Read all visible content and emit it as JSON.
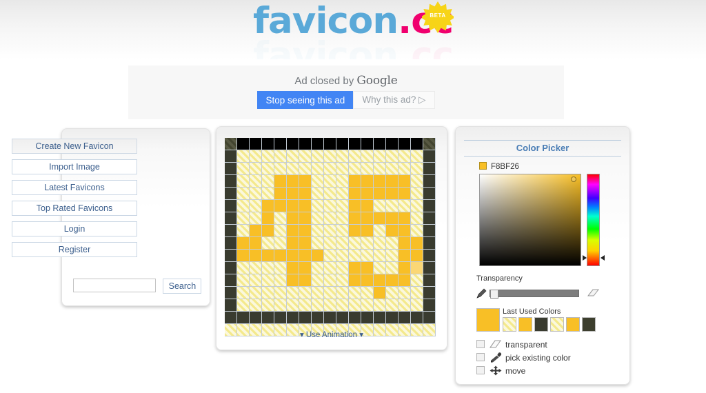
{
  "site": {
    "logo_part_blue": "favicon",
    "logo_part_dot": ".",
    "logo_part_pink": "cc",
    "logo_full": "favicon.cc",
    "beta_badge": "BETA",
    "logo_blue_color": "#5AA9D8",
    "logo_pink_color": "#F0006E",
    "beta_color": "#F7D417"
  },
  "ad": {
    "closed_text_prefix": "Ad closed by ",
    "closed_text_brand": "Google",
    "stop_seeing_label": "Stop seeing this ad",
    "why_this_ad_label": "Why this ad? ▷",
    "stop_button_color": "#4285F4"
  },
  "menu": {
    "items": [
      {
        "label": "Create New Favicon",
        "active": true
      },
      {
        "label": "Import Image",
        "active": false
      },
      {
        "label": "Latest Favicons",
        "active": false
      },
      {
        "label": "Top Rated Favicons",
        "active": false
      },
      {
        "label": "Login",
        "active": false
      },
      {
        "label": "Register",
        "active": false
      }
    ],
    "search_value": "",
    "search_placeholder": "",
    "search_button_label": "Search"
  },
  "editor": {
    "use_animation_label": "▾ Use Animation ▾",
    "grid_cols": 17,
    "grid_rows": 16,
    "palette": {
      "empty": "#F6F0B4",
      "yellow": "#F8BF26",
      "yellow_light": "#FBD775",
      "dark": "#393B2F",
      "black": "#000000",
      "darkolive": "#4A4B38"
    },
    "grid": [
      [
        "darkolive",
        "black",
        "black",
        "black",
        "black",
        "black",
        "black",
        "black",
        "black",
        "black",
        "black",
        "black",
        "black",
        "black",
        "black",
        "black",
        "darkolive"
      ],
      [
        "dark",
        "empty",
        "empty",
        "empty",
        "empty",
        "empty",
        "empty",
        "empty",
        "empty",
        "empty",
        "empty",
        "empty",
        "empty",
        "empty",
        "empty",
        "empty",
        "dark"
      ],
      [
        "dark",
        "empty",
        "empty",
        "empty",
        "empty",
        "empty",
        "empty",
        "empty",
        "empty",
        "empty",
        "empty",
        "empty",
        "empty",
        "empty",
        "empty",
        "empty",
        "dark"
      ],
      [
        "dark",
        "empty",
        "empty",
        "empty",
        "yellow",
        "yellow",
        "yellow",
        "empty",
        "empty",
        "empty",
        "yellow",
        "yellow",
        "yellow",
        "yellow",
        "yellow",
        "empty",
        "dark"
      ],
      [
        "dark",
        "empty",
        "empty",
        "empty",
        "yellow",
        "yellow",
        "yellow",
        "empty",
        "empty",
        "empty",
        "yellow",
        "yellow",
        "yellow",
        "yellow",
        "yellow",
        "empty",
        "dark"
      ],
      [
        "dark",
        "empty",
        "empty",
        "yellow",
        "yellow",
        "yellow",
        "yellow",
        "empty",
        "empty",
        "empty",
        "yellow",
        "yellow",
        "empty",
        "empty",
        "empty",
        "empty",
        "dark"
      ],
      [
        "dark",
        "empty",
        "empty",
        "yellow",
        "empty",
        "yellow",
        "yellow",
        "empty",
        "empty",
        "empty",
        "yellow",
        "yellow",
        "yellow",
        "yellow",
        "yellow",
        "empty",
        "dark"
      ],
      [
        "dark",
        "empty",
        "yellow",
        "yellow",
        "empty",
        "yellow",
        "yellow",
        "empty",
        "empty",
        "empty",
        "yellow",
        "yellow",
        "empty",
        "yellow",
        "yellow",
        "empty",
        "dark"
      ],
      [
        "dark",
        "yellow",
        "yellow",
        "empty",
        "empty",
        "yellow",
        "yellow",
        "empty",
        "empty",
        "empty",
        "empty",
        "empty",
        "empty",
        "empty",
        "yellow",
        "yellow",
        "dark"
      ],
      [
        "dark",
        "yellow",
        "yellow",
        "yellow",
        "yellow",
        "yellow",
        "yellow",
        "yellow",
        "empty",
        "empty",
        "empty",
        "empty",
        "empty",
        "empty",
        "yellow",
        "yellow",
        "dark"
      ],
      [
        "dark",
        "empty",
        "empty",
        "empty",
        "empty",
        "yellow",
        "yellow",
        "empty",
        "empty",
        "empty",
        "yellow",
        "yellow",
        "empty",
        "empty",
        "yellow",
        "yellow_light",
        "dark"
      ],
      [
        "dark",
        "empty",
        "empty",
        "empty",
        "empty",
        "yellow",
        "yellow",
        "empty",
        "empty",
        "empty",
        "yellow",
        "yellow",
        "yellow",
        "yellow",
        "yellow",
        "empty",
        "dark"
      ],
      [
        "dark",
        "empty",
        "empty",
        "empty",
        "empty",
        "empty",
        "empty",
        "empty",
        "empty",
        "empty",
        "empty",
        "empty",
        "yellow",
        "empty",
        "empty",
        "empty",
        "dark"
      ],
      [
        "dark",
        "empty",
        "empty",
        "empty",
        "empty",
        "empty",
        "empty",
        "empty",
        "empty",
        "empty",
        "empty",
        "empty",
        "empty",
        "empty",
        "empty",
        "empty",
        "dark"
      ],
      [
        "dark",
        "dark",
        "dark",
        "dark",
        "dark",
        "dark",
        "dark",
        "dark",
        "dark",
        "dark",
        "dark",
        "dark",
        "dark",
        "dark",
        "dark",
        "dark",
        "dark"
      ],
      [
        "empty",
        "empty",
        "empty",
        "empty",
        "empty",
        "empty",
        "empty",
        "empty",
        "empty",
        "empty",
        "empty",
        "empty",
        "empty",
        "empty",
        "empty",
        "empty",
        "empty"
      ]
    ]
  },
  "picker": {
    "title": "Color Picker",
    "hex_value": "F8BF26",
    "current_color": "#F8BF26",
    "transparency_label": "Transparency",
    "transparency_percent": 0,
    "last_used_label": "Last Used Colors",
    "last_used_colors": [
      {
        "name": "transparent",
        "hex": "transparent"
      },
      {
        "name": "yellow",
        "hex": "#F8BF26"
      },
      {
        "name": "dark",
        "hex": "#393B2F"
      },
      {
        "name": "transparent",
        "hex": "transparent"
      },
      {
        "name": "yellow",
        "hex": "#F8BF26"
      },
      {
        "name": "darkolive",
        "hex": "#3D3F2E"
      }
    ],
    "tools": [
      {
        "label": "transparent",
        "icon": "eraser-icon",
        "checked": false
      },
      {
        "label": "pick existing color",
        "icon": "eyedropper-icon",
        "checked": false
      },
      {
        "label": "move",
        "icon": "move-arrows-icon",
        "checked": false
      }
    ]
  }
}
